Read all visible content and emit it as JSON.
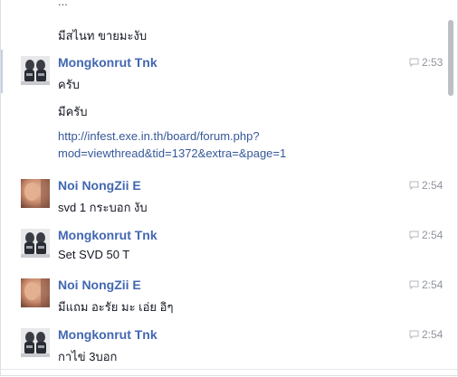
{
  "conversation": {
    "top_ellipsis": "...",
    "top_message": "มีสไนท ขายมะงับ",
    "groups": [
      {
        "sender": "Mongkonrut Tnk",
        "time": "2:53",
        "avatar_icon": "mongkonrut-avatar",
        "messages": [
          "ครับ",
          "มีครับ"
        ],
        "link_line1": "http://infest.exe.in.th/board/forum.php?",
        "link_line2": "mod=viewthread&tid=1372&extra=&page=1"
      },
      {
        "sender": "Noi NongZii E",
        "time": "2:54",
        "avatar_icon": "noi-avatar",
        "message": "svd 1 กระบอก งับ"
      },
      {
        "sender": "Mongkonrut Tnk",
        "time": "2:54",
        "avatar_icon": "mongkonrut-avatar",
        "message": "Set SVD 50 T"
      },
      {
        "sender": "Noi NongZii E",
        "time": "2:54",
        "avatar_icon": "noi-avatar",
        "message": "มีแถม อะรัย มะ เอ่ย อิๆ"
      },
      {
        "sender": "Mongkonrut Tnk",
        "time": "2:54",
        "avatar_icon": "mongkonrut-avatar",
        "message": "กาไข่ 3บอก"
      }
    ]
  },
  "colors": {
    "name": "#4267b2",
    "link": "#365899",
    "text": "#141823",
    "time": "#90949c",
    "scrollbar": "#bcc0c4"
  }
}
